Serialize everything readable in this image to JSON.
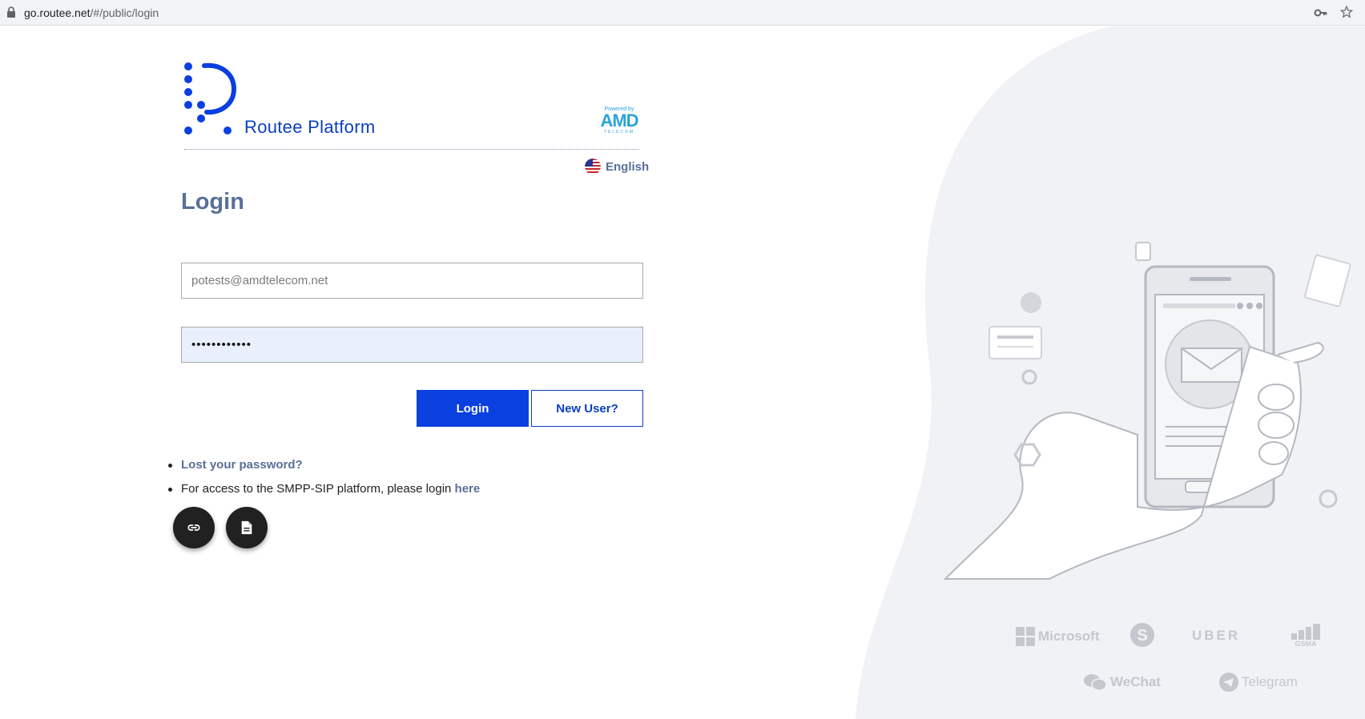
{
  "browser": {
    "url_host": "go.routee.net",
    "url_path": "/#/public/login"
  },
  "brand": {
    "name": "Routee Platform",
    "powered_by": "Powered by",
    "partner_logo": "AMD",
    "partner_sub": "TELECOM",
    "color": "#0a3fbf"
  },
  "language": {
    "label": "English",
    "flag": "us-flag-icon"
  },
  "page": {
    "title": "Login"
  },
  "form": {
    "email_placeholder": "potests@amdtelecom.net",
    "password_value": "••••••••••••",
    "login_label": "Login",
    "new_user_label": "New User?"
  },
  "links": {
    "lost_password": "Lost your password?",
    "smpp_text": "For access to the SMPP-SIP platform, please login ",
    "smpp_link": "here"
  },
  "fabs": [
    {
      "icon": "link-icon"
    },
    {
      "icon": "document-icon"
    }
  ],
  "partners": [
    "Microsoft",
    "UBER",
    "GSMA",
    "WeChat",
    "Telegram"
  ],
  "colors": {
    "primary": "#0a3fe0",
    "label": "#5a6f98",
    "autofill": "#e8f0fe"
  }
}
